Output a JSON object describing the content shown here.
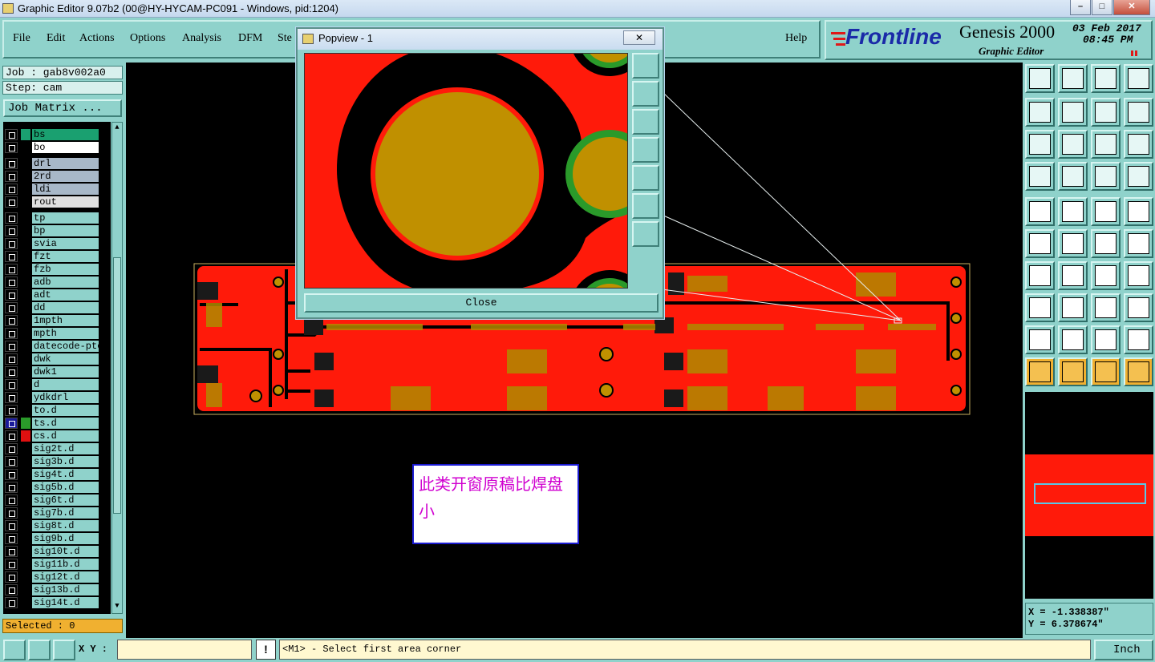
{
  "window": {
    "title": "Graphic Editor 9.07b2 (00@HY-HYCAM-PC091 - Windows, pid:1204)",
    "controls": [
      "–",
      "□",
      "✕"
    ]
  },
  "menu": [
    "File",
    "Edit",
    "Actions",
    "Options",
    "Analysis",
    "DFM",
    "Ste",
    "Help"
  ],
  "brand": {
    "logo": "Frontline",
    "product": "Genesis 2000",
    "subtitle": "Graphic Editor",
    "date": "03 Feb 2017",
    "time": "08:45 PM"
  },
  "job": {
    "job_label": "Job : gab8v002a0",
    "step_label": "Step: cam",
    "matrix_button": "Job Matrix ..."
  },
  "layers": [
    {
      "name": "bs",
      "color": "#1aa070",
      "bg": "#1aa070"
    },
    {
      "name": "bo",
      "color": "#000000",
      "bg": "#ffffff"
    },
    {
      "name": "drl",
      "color": "#000000",
      "bg": "#a8b8c8"
    },
    {
      "name": "2rd",
      "color": "#000000",
      "bg": "#a8b8c8"
    },
    {
      "name": "ldi",
      "color": "#000000",
      "bg": "#a8b8c8"
    },
    {
      "name": "rout",
      "color": "#000000",
      "bg": "#e0e0e0"
    },
    {
      "name": "tp",
      "color": "#000000",
      "bg": "#8fd2cb"
    },
    {
      "name": "bp",
      "color": "#000000",
      "bg": "#8fd2cb"
    },
    {
      "name": "svia",
      "color": "#000000",
      "bg": "#8fd2cb"
    },
    {
      "name": "fzt",
      "color": "#000000",
      "bg": "#8fd2cb"
    },
    {
      "name": "fzb",
      "color": "#000000",
      "bg": "#8fd2cb"
    },
    {
      "name": "adb",
      "color": "#000000",
      "bg": "#8fd2cb"
    },
    {
      "name": "adt",
      "color": "#000000",
      "bg": "#8fd2cb"
    },
    {
      "name": "dd",
      "color": "#000000",
      "bg": "#8fd2cb"
    },
    {
      "name": "1mpth",
      "color": "#000000",
      "bg": "#8fd2cb"
    },
    {
      "name": "mpth",
      "color": "#000000",
      "bg": "#8fd2cb"
    },
    {
      "name": "datecode-ptc",
      "color": "#000000",
      "bg": "#8fd2cb"
    },
    {
      "name": "dwk",
      "color": "#000000",
      "bg": "#8fd2cb"
    },
    {
      "name": "dwk1",
      "color": "#000000",
      "bg": "#8fd2cb"
    },
    {
      "name": "d",
      "color": "#000000",
      "bg": "#8fd2cb"
    },
    {
      "name": "ydkdrl",
      "color": "#000000",
      "bg": "#8fd2cb"
    },
    {
      "name": "to.d",
      "color": "#000000",
      "bg": "#8fd2cb"
    },
    {
      "name": "ts.d",
      "color": "#2a9a2a",
      "bg": "#8fd2cb",
      "active": true
    },
    {
      "name": "cs.d",
      "color": "#e01010",
      "bg": "#8fd2cb"
    },
    {
      "name": "sig2t.d",
      "color": "#000000",
      "bg": "#8fd2cb"
    },
    {
      "name": "sig3b.d",
      "color": "#000000",
      "bg": "#8fd2cb"
    },
    {
      "name": "sig4t.d",
      "color": "#000000",
      "bg": "#8fd2cb"
    },
    {
      "name": "sig5b.d",
      "color": "#000000",
      "bg": "#8fd2cb"
    },
    {
      "name": "sig6t.d",
      "color": "#000000",
      "bg": "#8fd2cb"
    },
    {
      "name": "sig7b.d",
      "color": "#000000",
      "bg": "#8fd2cb"
    },
    {
      "name": "sig8t.d",
      "color": "#000000",
      "bg": "#8fd2cb"
    },
    {
      "name": "sig9b.d",
      "color": "#000000",
      "bg": "#8fd2cb"
    },
    {
      "name": "sig10t.d",
      "color": "#000000",
      "bg": "#8fd2cb"
    },
    {
      "name": "sig11b.d",
      "color": "#000000",
      "bg": "#8fd2cb"
    },
    {
      "name": "sig12t.d",
      "color": "#000000",
      "bg": "#8fd2cb"
    },
    {
      "name": "sig13b.d",
      "color": "#000000",
      "bg": "#8fd2cb"
    },
    {
      "name": "sig14t.d",
      "color": "#000000",
      "bg": "#8fd2cb"
    }
  ],
  "selected": "Selected : 0",
  "popview": {
    "title": "Popview - 1",
    "close_label": "Close"
  },
  "note": "此类开窗原稿比焊盘小",
  "coords": {
    "x": "X = -1.338387\"",
    "y": "Y =  6.378674\""
  },
  "status": {
    "xy_label": "X Y :",
    "message": "<M1> - Select first area corner",
    "units": "Inch",
    "alert_icon": "!"
  },
  "colors": {
    "panel": "#8fd2cb",
    "board": "#ff1a0a",
    "pad": "#c09000",
    "ring": "#2a9a2a"
  }
}
